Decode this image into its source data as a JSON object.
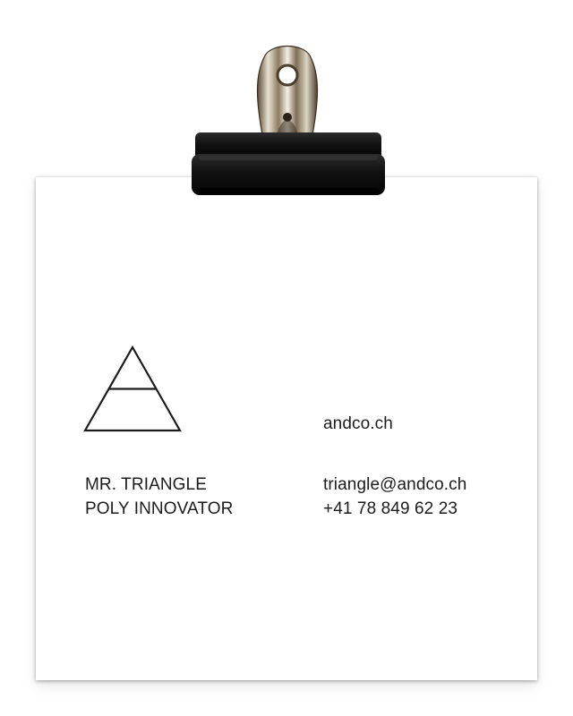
{
  "card": {
    "name": "MR. TRIANGLE",
    "title": "POLY INNOVATOR",
    "website": "andco.ch",
    "email": "triangle@andco.ch",
    "phone": "+41 78 849 62 23"
  },
  "icons": {
    "logo": "triangle-logo-icon",
    "clip": "binder-clip-icon"
  },
  "colors": {
    "paper": "#ffffff",
    "text": "#1c1c1c",
    "clip_black": "#141414",
    "clip_chrome": "#9a9a9a"
  }
}
